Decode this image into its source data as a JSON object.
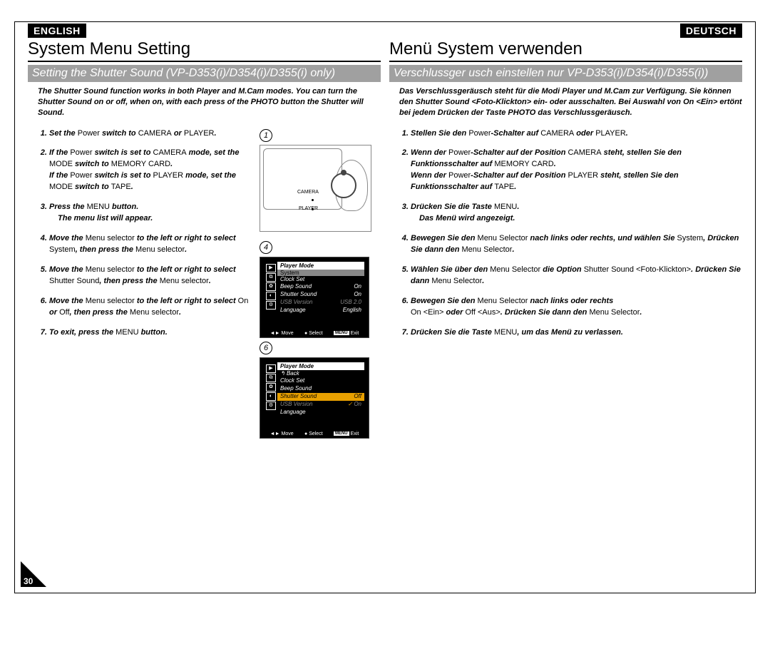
{
  "page_number": "30",
  "left": {
    "lang": "ENGLISH",
    "title": "System Menu Setting",
    "subtitle": "Setting the Shutter Sound (VP-D353(i)/D354(i)/D355(i) only)",
    "intro": "The Shutter Sound function works in both Player and M.Cam modes. You can turn the Shutter Sound on or off, when on, with each press of the PHOTO button the Shutter will Sound.",
    "steps": {
      "s1a": "Set the ",
      "s1b": "Power",
      "s1c": " switch to ",
      "s1d": "CAMERA",
      "s1e": " or ",
      "s1f": "PLAYER",
      "s1g": ".",
      "s2a": "If the ",
      "s2b": "Power",
      "s2c": " switch is set to ",
      "s2d": "CAMERA",
      "s2e": " mode, set the ",
      "s2f": "MODE",
      "s2g": " switch to ",
      "s2h": "MEMORY CARD",
      "s2i": ".",
      "s2j": "If the ",
      "s2k": "Power",
      "s2l": " switch is set to ",
      "s2m": "PLAYER",
      "s2n": " mode, set the ",
      "s2o": "MODE",
      "s2p": " switch to ",
      "s2q": "TAPE",
      "s2r": ".",
      "s3a": "Press the ",
      "s3b": "MENU",
      "s3c": " button.",
      "s3d": "The menu list will appear.",
      "s4a": "Move the ",
      "s4b": "Menu selector",
      "s4c": " to the left or right to select ",
      "s4d": "System",
      "s4e": ", then press the ",
      "s4f": "Menu selector",
      "s4g": ".",
      "s5a": "Move the ",
      "s5b": "Menu selector",
      "s5c": " to the left or right to select ",
      "s5d": "Shutter Sound",
      "s5e": ", then press the ",
      "s5f": "Menu selector",
      "s5g": ".",
      "s6a": "Move the ",
      "s6b": "Menu selector",
      "s6c": " to the left or right to select ",
      "s6d": "On",
      "s6e": " or ",
      "s6f": "Off",
      "s6g": ", then press the ",
      "s6h": "Menu selector",
      "s6i": ".",
      "s7a": "To exit, press the ",
      "s7b": "MENU",
      "s7c": " button."
    },
    "diagram": {
      "n1": "1",
      "n4": "4",
      "n6": "6",
      "camera": "CAMERA",
      "player": "PLAYER",
      "move": "Move",
      "select": "Select",
      "exit": "Exit",
      "menu_btn": "MENU"
    },
    "osd4": {
      "head": "Player Mode",
      "sub": "System",
      "r1": "Clock Set",
      "r2": "Beep Sound",
      "r2v": "On",
      "r3": "Shutter Sound",
      "r3v": "On",
      "r4": "USB Version",
      "r4v": "USB 2.0",
      "r5": "Language",
      "r5v": "English"
    },
    "osd6": {
      "head": "Player Mode",
      "sub": "Back",
      "r1": "Clock Set",
      "r2": "Beep Sound",
      "r3": "Shutter Sound",
      "r3v": "Off",
      "r4": "USB Version",
      "r4v": "On",
      "r5": "Language"
    }
  },
  "right": {
    "lang": "DEUTSCH",
    "title": "Menü System verwenden",
    "subtitle": "Verschlussger usch einstellen nur VP-D353(i)/D354(i)/D355(i))",
    "intro": "Das Verschlussgeräusch steht für die Modi Player und M.Cam zur Verfügung. Sie können den Shutter Sound <Foto-Klickton> ein- oder ausschalten. Bei Auswahl von On <Ein> ertönt bei jedem Drücken der Taste PHOTO das Verschlussgeräusch.",
    "steps": {
      "s1a": "Stellen Sie den ",
      "s1b": "Power",
      "s1c": "-Schalter auf ",
      "s1d": "CAMERA",
      "s1e": " oder ",
      "s1f": "PLAYER",
      "s1g": ".",
      "s2a": "Wenn der ",
      "s2b": "Power",
      "s2c": "-Schalter auf der Position ",
      "s2d": "CAMERA",
      "s2e": " steht, stellen Sie den Funktionsschalter auf ",
      "s2f": "MEMORY CARD",
      "s2g": ".",
      "s2h": "Wenn der ",
      "s2i": "Power",
      "s2j": "-Schalter auf der Position ",
      "s2k": "PLAYER",
      "s2l": " steht, stellen Sie den Funktionsschalter auf ",
      "s2m": "TAPE",
      "s2n": ".",
      "s3a": "Drücken Sie die Taste ",
      "s3b": "MENU",
      "s3c": ".",
      "s3d": "Das Menü wird angezeigt.",
      "s4a": "Bewegen Sie den ",
      "s4b": "Menu Selector",
      "s4c": " nach links oder rechts, und wählen Sie ",
      "s4d": "System",
      "s4e": ", Drücken Sie dann den ",
      "s4f": "Menu Selector",
      "s4g": ".",
      "s5a": "Wählen Sie über den ",
      "s5b": "Menu Selector",
      "s5c": " die Option ",
      "s5d": "Shutter Sound <Foto-Klickton>",
      "s5e": ". Drücken Sie dann ",
      "s5f": "Menu Selector",
      "s5g": ".",
      "s6a": "Bewegen Sie den ",
      "s6b": "Menu Selector",
      "s6c": " nach links oder rechts ",
      "s6d": "On <Ein>",
      "s6e": " oder ",
      "s6f": "Off <Aus>",
      "s6g": ". Drücken Sie dann den ",
      "s6h": "Menu Selector",
      "s6i": ".",
      "s7a": "Drücken Sie die Taste ",
      "s7b": "MENU",
      "s7c": ", um das Menü zu verlassen."
    }
  }
}
